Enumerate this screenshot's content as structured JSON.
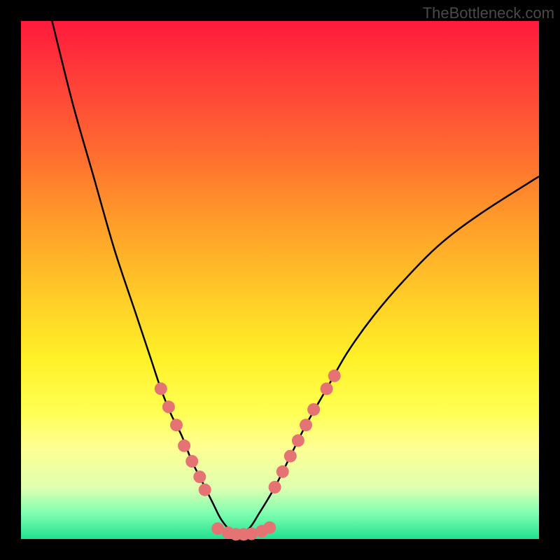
{
  "watermark": "TheBottleneck.com",
  "background": {
    "frame_color": "#000000",
    "gradient_stops": [
      "#ff1a3c",
      "#ff6a30",
      "#ffc828",
      "#ffff50",
      "#20e090"
    ]
  },
  "chart_data": {
    "type": "line",
    "title": "",
    "xlabel": "",
    "ylabel": "",
    "xlim": [
      0,
      100
    ],
    "ylim": [
      0,
      100
    ],
    "grid": false,
    "legend": false,
    "series": [
      {
        "name": "left-curve",
        "x": [
          6,
          10,
          14,
          18,
          22,
          25,
          27,
          29,
          31,
          33,
          35,
          37,
          38.5,
          40,
          41.5
        ],
        "y": [
          100,
          84,
          70,
          56,
          44,
          35,
          29,
          24,
          20,
          15,
          11,
          7,
          4,
          2,
          0.5
        ]
      },
      {
        "name": "right-curve",
        "x": [
          41.5,
          44,
          46,
          49,
          52,
          55,
          59,
          63,
          68,
          74,
          81,
          89,
          100
        ],
        "y": [
          0.5,
          2,
          5,
          10,
          16,
          22,
          29,
          36,
          43,
          50,
          57,
          63,
          70
        ]
      },
      {
        "name": "bottom-flat",
        "x": [
          38,
          40,
          42,
          44,
          46,
          48
        ],
        "y": [
          1.5,
          1.0,
          0.8,
          0.8,
          1.0,
          1.5
        ]
      }
    ],
    "markers": [
      {
        "series": "left",
        "x": 27,
        "y": 29
      },
      {
        "series": "left",
        "x": 28.5,
        "y": 25.5
      },
      {
        "series": "left",
        "x": 30,
        "y": 22
      },
      {
        "series": "left",
        "x": 31.5,
        "y": 18
      },
      {
        "series": "left",
        "x": 33,
        "y": 15
      },
      {
        "series": "left",
        "x": 34.5,
        "y": 12
      },
      {
        "series": "left",
        "x": 35.5,
        "y": 9.5
      },
      {
        "series": "bottom",
        "x": 38,
        "y": 2
      },
      {
        "series": "bottom",
        "x": 40,
        "y": 1.2
      },
      {
        "series": "bottom",
        "x": 41.5,
        "y": 0.9
      },
      {
        "series": "bottom",
        "x": 43,
        "y": 0.9
      },
      {
        "series": "bottom",
        "x": 44.5,
        "y": 1.0
      },
      {
        "series": "bottom",
        "x": 46.5,
        "y": 1.5
      },
      {
        "series": "bottom",
        "x": 48,
        "y": 2.2
      },
      {
        "series": "right",
        "x": 49,
        "y": 10
      },
      {
        "series": "right",
        "x": 50.5,
        "y": 13
      },
      {
        "series": "right",
        "x": 52,
        "y": 16
      },
      {
        "series": "right",
        "x": 53.5,
        "y": 19
      },
      {
        "series": "right",
        "x": 55,
        "y": 22
      },
      {
        "series": "right",
        "x": 56.5,
        "y": 25
      },
      {
        "series": "right",
        "x": 59,
        "y": 29
      },
      {
        "series": "right",
        "x": 60.5,
        "y": 31.5
      }
    ],
    "marker_style": {
      "color": "#e57373",
      "size": 9
    }
  }
}
